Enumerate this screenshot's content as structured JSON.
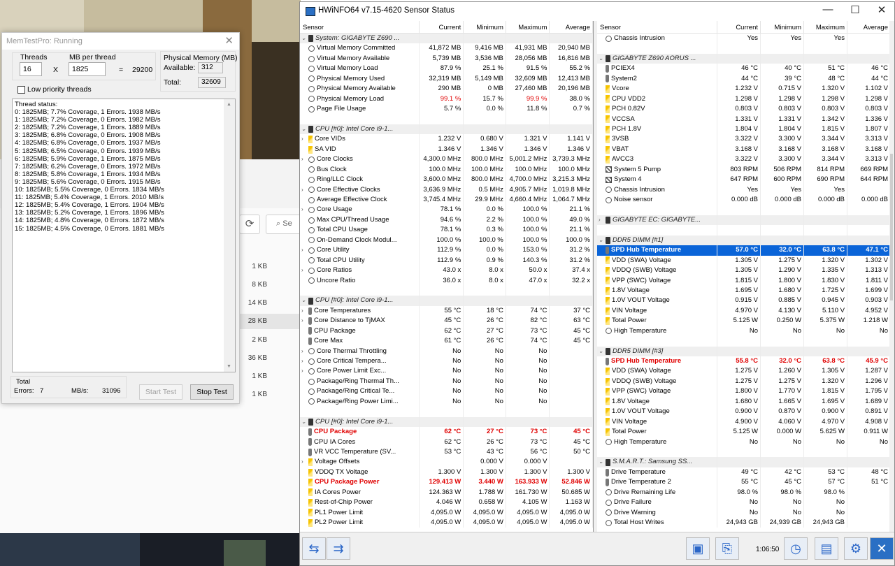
{
  "memtest": {
    "title": "MemTestPro: Running",
    "threads_label": "Threads",
    "threads_value": "16",
    "times": "X",
    "mb_label": "MB per thread",
    "mb_value": "1825",
    "equals": "=",
    "total_mb": "29200",
    "phys_label": "Physical Memory (MB)",
    "available_label": "Available:",
    "available_value": "312",
    "total_label": "Total:",
    "total_value": "32609",
    "low_priority": "Low priority threads",
    "status_title": "Thread status:",
    "status_lines": [
      "0: 1825MB;  7.7% Coverage, 1 Errors. 1938 MB/s",
      "1: 1825MB;  7.2% Coverage, 0 Errors. 1982 MB/s",
      "2: 1825MB;  7.2% Coverage, 1 Errors. 1889 MB/s",
      "3: 1825MB;  6.8% Coverage, 0 Errors. 1908 MB/s",
      "4: 1825MB;  6.8% Coverage, 0 Errors. 1937 MB/s",
      "5: 1825MB;  6.5% Coverage, 0 Errors. 1939 MB/s",
      "6: 1825MB;  5.9% Coverage, 1 Errors. 1875 MB/s",
      "7: 1825MB;  6.2% Coverage, 0 Errors. 1972 MB/s",
      "8: 1825MB;  5.8% Coverage, 1 Errors. 1934 MB/s",
      "9: 1825MB;  5.6% Coverage, 0 Errors. 1915 MB/s",
      "10: 1825MB;  5.5% Coverage, 0 Errors. 1834 MB/s",
      "11: 1825MB;  5.4% Coverage, 1 Errors. 2010 MB/s",
      "12: 1825MB;  5.4% Coverage, 1 Errors. 1904 MB/s",
      "13: 1825MB;  5.2% Coverage, 1 Errors. 1896 MB/s",
      "14: 1825MB;  4.8% Coverage, 0 Errors. 1872 MB/s",
      "15: 1825MB;  4.5% Coverage, 0 Errors. 1881 MB/s"
    ],
    "total_group": "Total",
    "errors_label": "Errors:",
    "errors_value": "7",
    "mbs_label": "MB/s:",
    "mbs_value": "31096",
    "start_btn": "Start Test",
    "stop_btn": "Stop Test"
  },
  "explorer": {
    "search_placeholder": "Se",
    "sizes": [
      "1 KB",
      "8 KB",
      "14 KB",
      "28 KB",
      "2 KB",
      "36 KB",
      "1 KB",
      "1 KB"
    ]
  },
  "hwinfo": {
    "title": "HWiNFO64 v7.15-4620 Sensor Status",
    "columns": [
      "Sensor",
      "Current",
      "Minimum",
      "Maximum",
      "Average"
    ],
    "left": [
      {
        "t": "g",
        "ex": "⌄",
        "n": "System: GIGABYTE Z690 ..."
      },
      {
        "ic": "cir",
        "n": "Virtual Memory Committed",
        "v": [
          "41,872 MB",
          "9,416 MB",
          "41,931 MB",
          "20,940 MB"
        ]
      },
      {
        "ic": "cir",
        "n": "Virtual Memory Available",
        "v": [
          "5,739 MB",
          "3,536 MB",
          "28,056 MB",
          "16,816 MB"
        ]
      },
      {
        "ic": "cir",
        "n": "Virtual Memory Load",
        "v": [
          "87.9 %",
          "25.1 %",
          "91.5 %",
          "55.2 %"
        ]
      },
      {
        "ic": "cir",
        "n": "Physical Memory Used",
        "v": [
          "32,319 MB",
          "5,149 MB",
          "32,609 MB",
          "12,413 MB"
        ]
      },
      {
        "ic": "cir",
        "n": "Physical Memory Available",
        "v": [
          "290 MB",
          "0 MB",
          "27,460 MB",
          "20,196 MB"
        ]
      },
      {
        "ic": "cir",
        "n": "Physical Memory Load",
        "v": [
          "99.1 %",
          "15.7 %",
          "99.9 %",
          "38.0 %"
        ],
        "rc": [
          0,
          2
        ]
      },
      {
        "ic": "cir",
        "n": "Page File Usage",
        "v": [
          "5.7 %",
          "0.0 %",
          "11.8 %",
          "0.7 %"
        ]
      },
      {
        "t": "b"
      },
      {
        "t": "g",
        "ex": "⌄",
        "n": "CPU [#0]: Intel Core i9-1..."
      },
      {
        "ex": "›",
        "ic": "bolt",
        "n": "Core VIDs",
        "v": [
          "1.232 V",
          "0.680 V",
          "1.321 V",
          "1.141 V"
        ]
      },
      {
        "ic": "bolt",
        "n": "SA VID",
        "v": [
          "1.346 V",
          "1.346 V",
          "1.346 V",
          "1.346 V"
        ]
      },
      {
        "ex": "›",
        "ic": "cir",
        "n": "Core Clocks",
        "v": [
          "4,300.0 MHz",
          "800.0 MHz",
          "5,001.2 MHz",
          "3,739.3 MHz"
        ]
      },
      {
        "ic": "cir",
        "n": "Bus Clock",
        "v": [
          "100.0 MHz",
          "100.0 MHz",
          "100.0 MHz",
          "100.0 MHz"
        ]
      },
      {
        "ic": "cir",
        "n": "Ring/LLC Clock",
        "v": [
          "3,600.0 MHz",
          "800.0 MHz",
          "4,700.0 MHz",
          "3,215.3 MHz"
        ]
      },
      {
        "ex": "›",
        "ic": "cir",
        "n": "Core Effective Clocks",
        "v": [
          "3,636.9 MHz",
          "0.5 MHz",
          "4,905.7 MHz",
          "1,019.8 MHz"
        ]
      },
      {
        "ic": "cir",
        "n": "Average Effective Clock",
        "v": [
          "3,745.4 MHz",
          "29.9 MHz",
          "4,660.4 MHz",
          "1,064.7 MHz"
        ]
      },
      {
        "ex": "›",
        "ic": "cir",
        "n": "Core Usage",
        "v": [
          "78.1 %",
          "0.0 %",
          "100.0 %",
          "21.1 %"
        ]
      },
      {
        "ic": "cir",
        "n": "Max CPU/Thread Usage",
        "v": [
          "94.6 %",
          "2.2 %",
          "100.0 %",
          "49.0 %"
        ]
      },
      {
        "ic": "cir",
        "n": "Total CPU Usage",
        "v": [
          "78.1 %",
          "0.3 %",
          "100.0 %",
          "21.1 %"
        ]
      },
      {
        "ic": "cir",
        "n": "On-Demand Clock Modul...",
        "v": [
          "100.0 %",
          "100.0 %",
          "100.0 %",
          "100.0 %"
        ]
      },
      {
        "ex": "›",
        "ic": "cir",
        "n": "Core Utility",
        "v": [
          "112.9 %",
          "0.0 %",
          "153.0 %",
          "31.2 %"
        ]
      },
      {
        "ic": "cir",
        "n": "Total CPU Utility",
        "v": [
          "112.9 %",
          "0.9 %",
          "140.3 %",
          "31.2 %"
        ]
      },
      {
        "ex": "›",
        "ic": "cir",
        "n": "Core Ratios",
        "v": [
          "43.0 x",
          "8.0 x",
          "50.0 x",
          "37.4 x"
        ]
      },
      {
        "ic": "cir",
        "n": "Uncore Ratio",
        "v": [
          "36.0 x",
          "8.0 x",
          "47.0 x",
          "32.2 x"
        ]
      },
      {
        "t": "b"
      },
      {
        "t": "g",
        "ex": "⌄",
        "n": "CPU [#0]: Intel Core i9-1..."
      },
      {
        "ex": "›",
        "ic": "th",
        "n": "Core Temperatures",
        "v": [
          "55 °C",
          "18 °C",
          "74 °C",
          "37 °C"
        ]
      },
      {
        "ex": "›",
        "ic": "th",
        "n": "Core Distance to TjMAX",
        "v": [
          "45 °C",
          "26 °C",
          "82 °C",
          "63 °C"
        ]
      },
      {
        "ic": "th",
        "n": "CPU Package",
        "v": [
          "62 °C",
          "27 °C",
          "73 °C",
          "45 °C"
        ]
      },
      {
        "ic": "th",
        "n": "Core Max",
        "v": [
          "61 °C",
          "26 °C",
          "74 °C",
          "45 °C"
        ]
      },
      {
        "ex": "›",
        "ic": "cir",
        "n": "Core Thermal Throttling",
        "v": [
          "No",
          "No",
          "No",
          ""
        ]
      },
      {
        "ex": "›",
        "ic": "cir",
        "n": "Core Critical Tempera...",
        "v": [
          "No",
          "No",
          "No",
          ""
        ]
      },
      {
        "ex": "›",
        "ic": "cir",
        "n": "Core Power Limit Exc...",
        "v": [
          "No",
          "No",
          "No",
          ""
        ]
      },
      {
        "ic": "cir",
        "n": "Package/Ring Thermal Th...",
        "v": [
          "No",
          "No",
          "No",
          ""
        ]
      },
      {
        "ic": "cir",
        "n": "Package/Ring Critical Te...",
        "v": [
          "No",
          "No",
          "No",
          ""
        ]
      },
      {
        "ic": "cir",
        "n": "Package/Ring Power Limi...",
        "v": [
          "No",
          "No",
          "No",
          ""
        ]
      },
      {
        "t": "b"
      },
      {
        "t": "g",
        "ex": "⌄",
        "n": "CPU [#0]: Intel Core i9-1..."
      },
      {
        "t": "r",
        "ic": "th",
        "n": "CPU Package",
        "v": [
          "62 °C",
          "27 °C",
          "73 °C",
          "45 °C"
        ]
      },
      {
        "ic": "th",
        "n": "CPU IA Cores",
        "v": [
          "62 °C",
          "26 °C",
          "73 °C",
          "45 °C"
        ]
      },
      {
        "ic": "th",
        "n": "VR VCC Temperature (SV...",
        "v": [
          "53 °C",
          "43 °C",
          "56 °C",
          "50 °C"
        ]
      },
      {
        "ex": "›",
        "ic": "bolt",
        "n": "Voltage Offsets",
        "v": [
          "",
          "0.000 V",
          "0.000 V",
          ""
        ]
      },
      {
        "ic": "bolt",
        "n": "VDDQ TX Voltage",
        "v": [
          "1.300 V",
          "1.300 V",
          "1.300 V",
          "1.300 V"
        ]
      },
      {
        "t": "r",
        "ic": "bolt",
        "n": "CPU Package Power",
        "v": [
          "129.413 W",
          "3.440 W",
          "163.933 W",
          "52.846 W"
        ]
      },
      {
        "ic": "bolt",
        "n": "IA Cores Power",
        "v": [
          "124.363 W",
          "1.788 W",
          "161.730 W",
          "50.685 W"
        ]
      },
      {
        "ic": "bolt",
        "n": "Rest-of-Chip Power",
        "v": [
          "4.046 W",
          "0.658 W",
          "4.105 W",
          "1.163 W"
        ]
      },
      {
        "ic": "bolt",
        "n": "PL1 Power Limit",
        "v": [
          "4,095.0 W",
          "4,095.0 W",
          "4,095.0 W",
          "4,095.0 W"
        ]
      },
      {
        "ic": "bolt",
        "n": "PL2 Power Limit",
        "v": [
          "4,095.0 W",
          "4,095.0 W",
          "4,095.0 W",
          "4,095.0 W"
        ]
      }
    ],
    "right": [
      {
        "ic": "cir",
        "n": "Chassis Intrusion",
        "v": [
          "Yes",
          "Yes",
          "Yes",
          ""
        ]
      },
      {
        "t": "b"
      },
      {
        "t": "g",
        "ex": "⌄",
        "n": "GIGABYTE Z690 AORUS ..."
      },
      {
        "ic": "th",
        "n": "PCIEX4",
        "v": [
          "46 °C",
          "40 °C",
          "51 °C",
          "46 °C"
        ]
      },
      {
        "ic": "th",
        "n": "System2",
        "v": [
          "44 °C",
          "39 °C",
          "48 °C",
          "44 °C"
        ]
      },
      {
        "ic": "bolt",
        "n": "Vcore",
        "v": [
          "1.232 V",
          "0.715 V",
          "1.320 V",
          "1.102 V"
        ]
      },
      {
        "ic": "bolt",
        "n": "CPU VDD2",
        "v": [
          "1.298 V",
          "1.298 V",
          "1.298 V",
          "1.298 V"
        ]
      },
      {
        "ic": "bolt",
        "n": "PCH 0.82V",
        "v": [
          "0.803 V",
          "0.803 V",
          "0.803 V",
          "0.803 V"
        ]
      },
      {
        "ic": "bolt",
        "n": "VCCSA",
        "v": [
          "1.331 V",
          "1.331 V",
          "1.342 V",
          "1.336 V"
        ]
      },
      {
        "ic": "bolt",
        "n": "PCH 1.8V",
        "v": [
          "1.804 V",
          "1.804 V",
          "1.815 V",
          "1.807 V"
        ]
      },
      {
        "ic": "bolt",
        "n": "3VSB",
        "v": [
          "3.322 V",
          "3.300 V",
          "3.344 V",
          "3.313 V"
        ]
      },
      {
        "ic": "bolt",
        "n": "VBAT",
        "v": [
          "3.168 V",
          "3.168 V",
          "3.168 V",
          "3.168 V"
        ]
      },
      {
        "ic": "bolt",
        "n": "AVCC3",
        "v": [
          "3.322 V",
          "3.300 V",
          "3.344 V",
          "3.313 V"
        ]
      },
      {
        "ic": "fan",
        "n": "System 5 Pump",
        "v": [
          "803 RPM",
          "506 RPM",
          "814 RPM",
          "669 RPM"
        ]
      },
      {
        "ic": "fan",
        "n": "System 4",
        "v": [
          "647 RPM",
          "600 RPM",
          "690 RPM",
          "644 RPM"
        ]
      },
      {
        "ic": "cir",
        "n": "Chassis Intrusion",
        "v": [
          "Yes",
          "Yes",
          "Yes",
          ""
        ]
      },
      {
        "ic": "cir",
        "n": "Noise sensor",
        "v": [
          "0.000 dB",
          "0.000 dB",
          "0.000 dB",
          "0.000 dB"
        ]
      },
      {
        "t": "b"
      },
      {
        "t": "g",
        "ex": "›",
        "n": "GIGABYTE EC: GIGABYTE..."
      },
      {
        "t": "b"
      },
      {
        "t": "g",
        "ex": "⌄",
        "n": "DDR5 DIMM [#1]"
      },
      {
        "t": "s",
        "ic": "th",
        "n": "SPD Hub Temperature",
        "v": [
          "57.0 °C",
          "32.0 °C",
          "63.8 °C",
          "47.1 °C"
        ]
      },
      {
        "ic": "bolt",
        "n": "VDD (SWA) Voltage",
        "v": [
          "1.305 V",
          "1.275 V",
          "1.320 V",
          "1.302 V"
        ]
      },
      {
        "ic": "bolt",
        "n": "VDDQ (SWB) Voltage",
        "v": [
          "1.305 V",
          "1.290 V",
          "1.335 V",
          "1.313 V"
        ]
      },
      {
        "ic": "bolt",
        "n": "VPP (SWC) Voltage",
        "v": [
          "1.815 V",
          "1.800 V",
          "1.830 V",
          "1.811 V"
        ]
      },
      {
        "ic": "bolt",
        "n": "1.8V Voltage",
        "v": [
          "1.695 V",
          "1.680 V",
          "1.725 V",
          "1.699 V"
        ]
      },
      {
        "ic": "bolt",
        "n": "1.0V VOUT Voltage",
        "v": [
          "0.915 V",
          "0.885 V",
          "0.945 V",
          "0.903 V"
        ]
      },
      {
        "ic": "bolt",
        "n": "VIN Voltage",
        "v": [
          "4.970 V",
          "4.130 V",
          "5.110 V",
          "4.952 V"
        ]
      },
      {
        "ic": "bolt",
        "n": "Total Power",
        "v": [
          "5.125 W",
          "0.250 W",
          "5.375 W",
          "1.218 W"
        ]
      },
      {
        "ic": "cir",
        "n": "High Temperature",
        "v": [
          "No",
          "No",
          "No",
          "No"
        ]
      },
      {
        "t": "b"
      },
      {
        "t": "g",
        "ex": "⌄",
        "n": "DDR5 DIMM [#3]"
      },
      {
        "t": "r",
        "ic": "th",
        "n": "SPD Hub Temperature",
        "v": [
          "55.8 °C",
          "32.0 °C",
          "63.8 °C",
          "45.9 °C"
        ]
      },
      {
        "ic": "bolt",
        "n": "VDD (SWA) Voltage",
        "v": [
          "1.275 V",
          "1.260 V",
          "1.305 V",
          "1.287 V"
        ]
      },
      {
        "ic": "bolt",
        "n": "VDDQ (SWB) Voltage",
        "v": [
          "1.275 V",
          "1.275 V",
          "1.320 V",
          "1.296 V"
        ]
      },
      {
        "ic": "bolt",
        "n": "VPP (SWC) Voltage",
        "v": [
          "1.800 V",
          "1.770 V",
          "1.815 V",
          "1.795 V"
        ]
      },
      {
        "ic": "bolt",
        "n": "1.8V Voltage",
        "v": [
          "1.680 V",
          "1.665 V",
          "1.695 V",
          "1.689 V"
        ]
      },
      {
        "ic": "bolt",
        "n": "1.0V VOUT Voltage",
        "v": [
          "0.900 V",
          "0.870 V",
          "0.900 V",
          "0.891 V"
        ]
      },
      {
        "ic": "bolt",
        "n": "VIN Voltage",
        "v": [
          "4.900 V",
          "4.060 V",
          "4.970 V",
          "4.908 V"
        ]
      },
      {
        "ic": "bolt",
        "n": "Total Power",
        "v": [
          "5.125 W",
          "0.000 W",
          "5.625 W",
          "0.911 W"
        ]
      },
      {
        "ic": "cir",
        "n": "High Temperature",
        "v": [
          "No",
          "No",
          "No",
          "No"
        ]
      },
      {
        "t": "b"
      },
      {
        "t": "g",
        "ex": "⌄",
        "n": "S.M.A.R.T.: Samsung SS..."
      },
      {
        "ic": "th",
        "n": "Drive Temperature",
        "v": [
          "49 °C",
          "42 °C",
          "53 °C",
          "48 °C"
        ]
      },
      {
        "ic": "th",
        "n": "Drive Temperature 2",
        "v": [
          "55 °C",
          "45 °C",
          "57 °C",
          "51 °C"
        ]
      },
      {
        "ic": "cir",
        "n": "Drive Remaining Life",
        "v": [
          "98.0 %",
          "98.0 %",
          "98.0 %",
          ""
        ]
      },
      {
        "ic": "cir",
        "n": "Drive Failure",
        "v": [
          "No",
          "No",
          "No",
          ""
        ]
      },
      {
        "ic": "cir",
        "n": "Drive Warning",
        "v": [
          "No",
          "No",
          "No",
          ""
        ]
      },
      {
        "ic": "cir",
        "n": "Total Host Writes",
        "v": [
          "24,943 GB",
          "24,939 GB",
          "24,943 GB",
          ""
        ]
      }
    ],
    "timer": "1:06:50"
  }
}
